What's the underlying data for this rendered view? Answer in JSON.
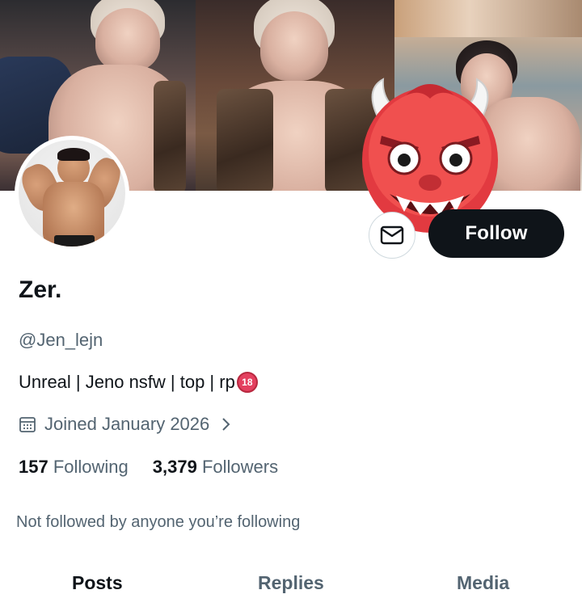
{
  "profile": {
    "name": "Zer.",
    "handle": "@Jen_lejn",
    "bio": "Unreal | Jeno nsfw | top | rp",
    "bio_badge": "18",
    "joined": "Joined January 2026",
    "following_count": "157",
    "following_label": "Following",
    "followers_count": "3,379",
    "followers_label": "Followers",
    "not_followed_text": "Not followed by anyone you’re following"
  },
  "actions": {
    "follow_label": "Follow"
  },
  "tabs": [
    {
      "label": "Posts",
      "active": true
    },
    {
      "label": "Replies",
      "active": false
    },
    {
      "label": "Media",
      "active": false
    }
  ],
  "colors": {
    "primary_text": "#0f1419",
    "secondary_text": "#536471",
    "follow_button": "#0f1419",
    "badge": "#e4405f"
  },
  "icons": {
    "message": "envelope-icon",
    "joined": "calendar-icon",
    "joined_chevron": "chevron-right-icon",
    "overlay": "devil-emoji"
  }
}
